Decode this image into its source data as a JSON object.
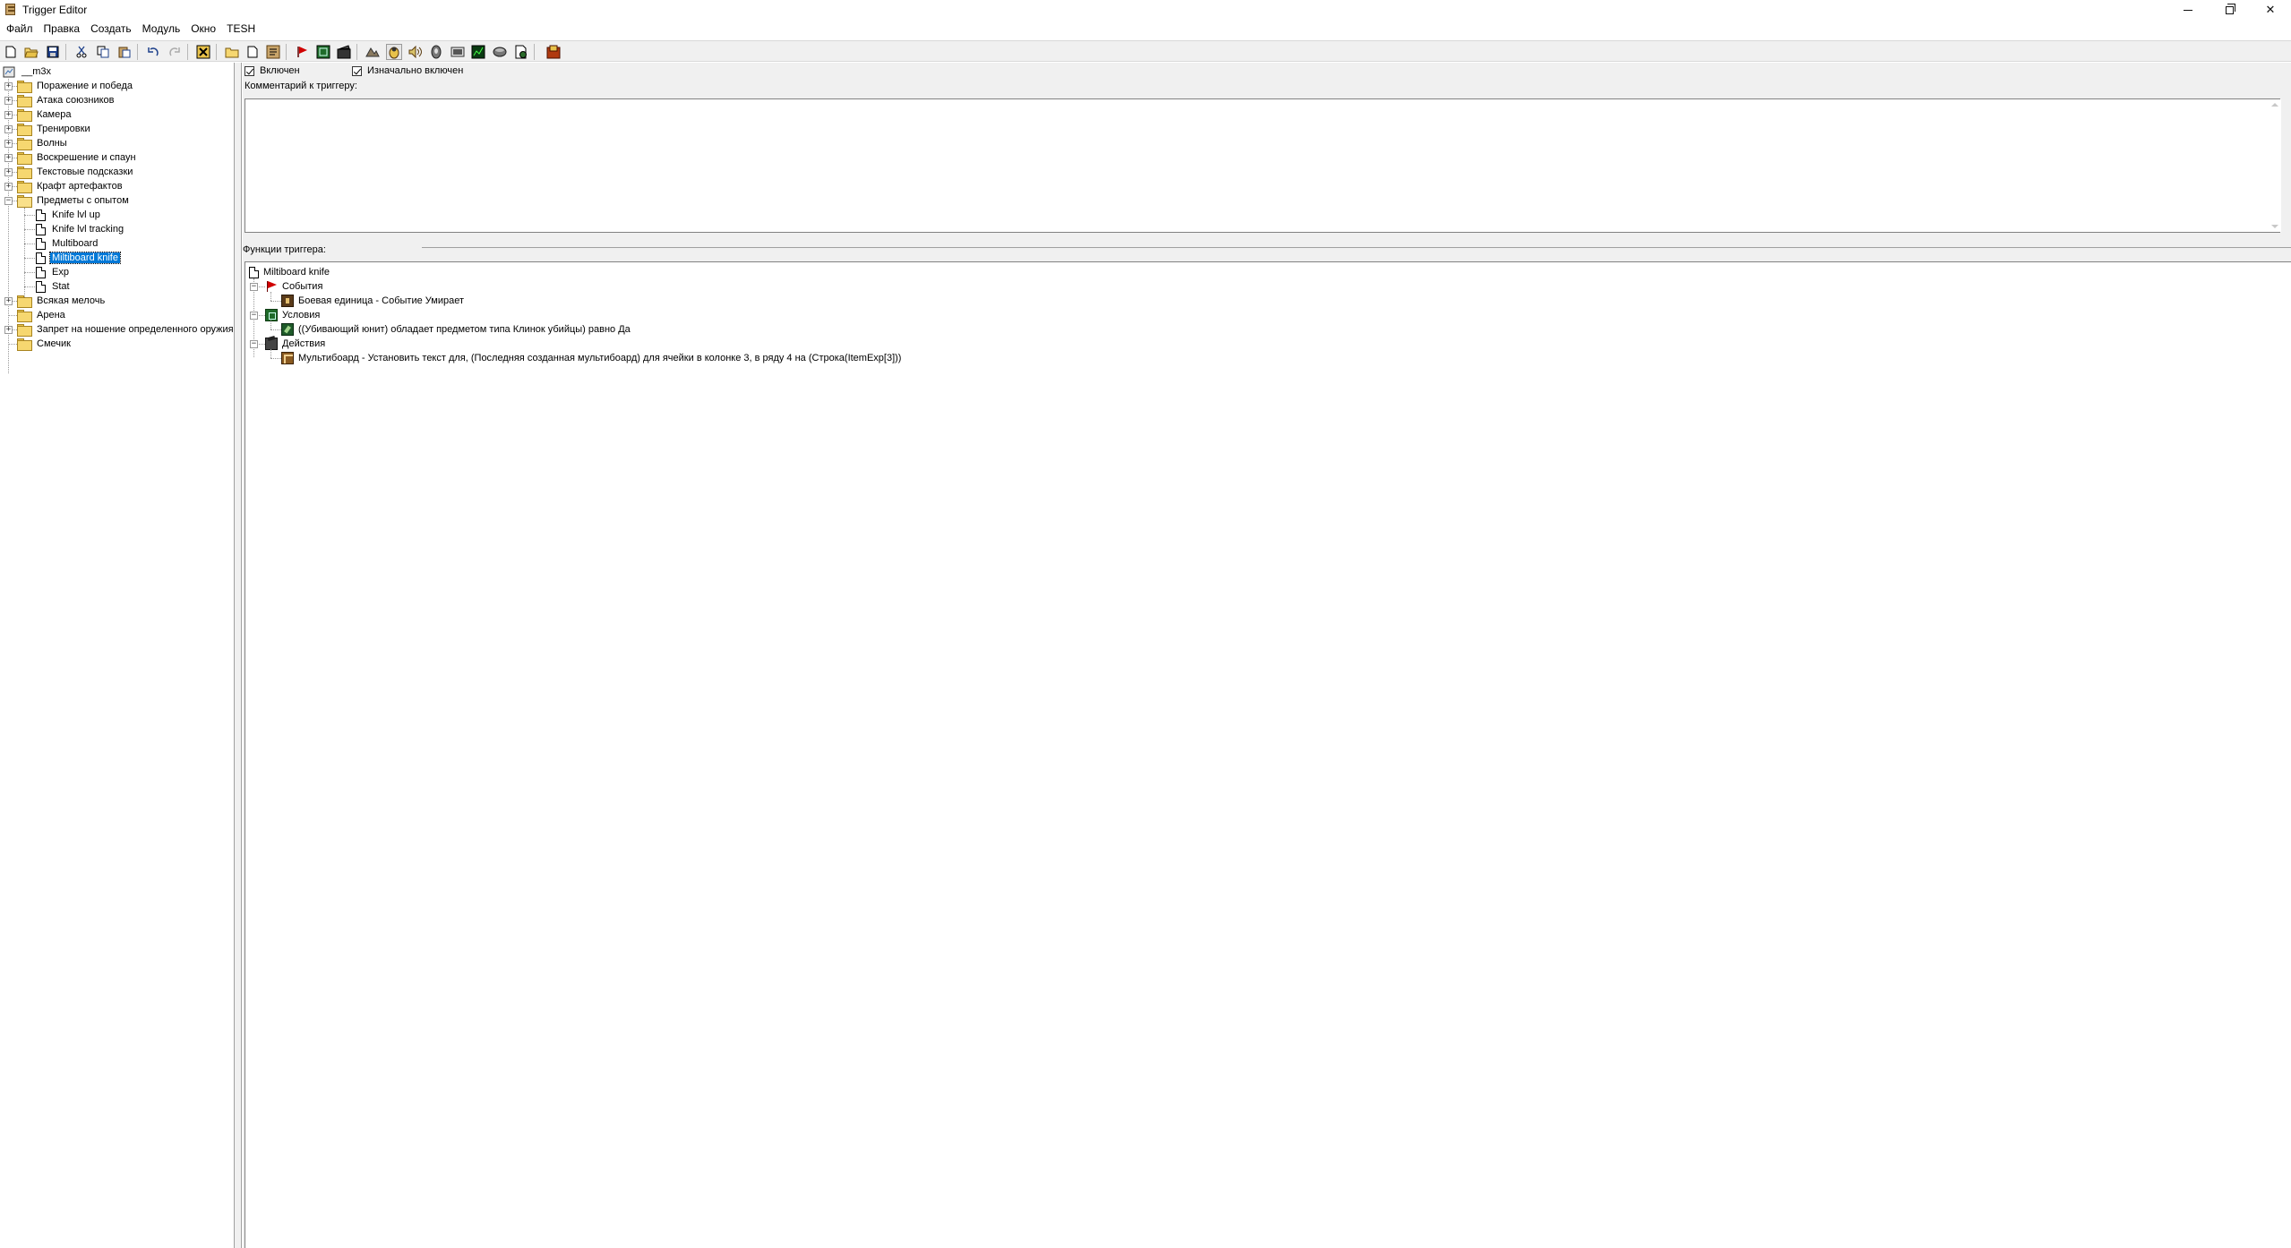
{
  "window": {
    "title": "Trigger Editor"
  },
  "menu": [
    "Файл",
    "Правка",
    "Создать",
    "Модуль",
    "Окно",
    "TESH"
  ],
  "toolbar": {
    "icons": [
      "new-doc-icon",
      "open-icon",
      "save-icon",
      "cut-icon",
      "copy-icon",
      "paste-icon",
      "undo-icon",
      "redo-icon",
      "delete-icon",
      "new-category-icon",
      "new-trigger-icon",
      "new-comment-icon",
      "new-event-icon",
      "new-condition-icon",
      "new-action-icon",
      "terrain-editor-icon",
      "unit-editor-icon",
      "sound-editor-icon",
      "object-editor-icon",
      "campaign-editor-icon",
      "ai-editor-icon",
      "import-manager-icon",
      "test-map-icon",
      "tesh-icon"
    ]
  },
  "tree": {
    "root": "__m3x",
    "items": [
      {
        "label": "Поражение и победа",
        "type": "folder",
        "expander": "+"
      },
      {
        "label": "Атака союзников",
        "type": "folder",
        "expander": "+"
      },
      {
        "label": "Камера",
        "type": "folder",
        "expander": "+"
      },
      {
        "label": "Тренировки",
        "type": "folder",
        "expander": "+"
      },
      {
        "label": "Волны",
        "type": "folder",
        "expander": "+"
      },
      {
        "label": "Воскрешение и спаун",
        "type": "folder",
        "expander": "+"
      },
      {
        "label": "Текстовые подсказки",
        "type": "folder",
        "expander": "+"
      },
      {
        "label": "Крафт артефактов",
        "type": "folder",
        "expander": "+"
      },
      {
        "label": "Предметы с опытом",
        "type": "folder-open",
        "expander": "−"
      },
      {
        "label": "Knife lvl up",
        "type": "trigger",
        "child": true
      },
      {
        "label": "Knife lvl tracking",
        "type": "trigger",
        "child": true
      },
      {
        "label": "Multiboard",
        "type": "trigger",
        "child": true
      },
      {
        "label": "Miltiboard knife",
        "type": "trigger",
        "child": true,
        "selected": true
      },
      {
        "label": "Exp",
        "type": "trigger",
        "child": true
      },
      {
        "label": "Stat",
        "type": "trigger",
        "child": true
      },
      {
        "label": "Всякая мелочь",
        "type": "folder",
        "expander": "+"
      },
      {
        "label": "Арена",
        "type": "folder"
      },
      {
        "label": "Запрет на ношение определенного оружия",
        "type": "folder",
        "expander": "+"
      },
      {
        "label": "Смечик",
        "type": "folder"
      }
    ]
  },
  "trigger": {
    "enabled_label": "Включен",
    "initially_on_label": "Изначально включен",
    "comment_label": "Комментарий к триггеру:",
    "comment_value": "",
    "functions_label": "Функции триггера:"
  },
  "functions": {
    "name": "Miltiboard knife",
    "events_label": "События",
    "event": "Боевая единица - Событие Умирает",
    "conditions_label": "Условия",
    "condition": "((Убивающий юнит) обладает предметом типа Клинок убийцы) равно Да",
    "actions_label": "Действия",
    "action": "Мультибоард - Установить текст для,  (Последняя созданная мультибоард) для ячейки в колонке 3, в ряду 4 на (Строка(ItemExp[3]))"
  }
}
